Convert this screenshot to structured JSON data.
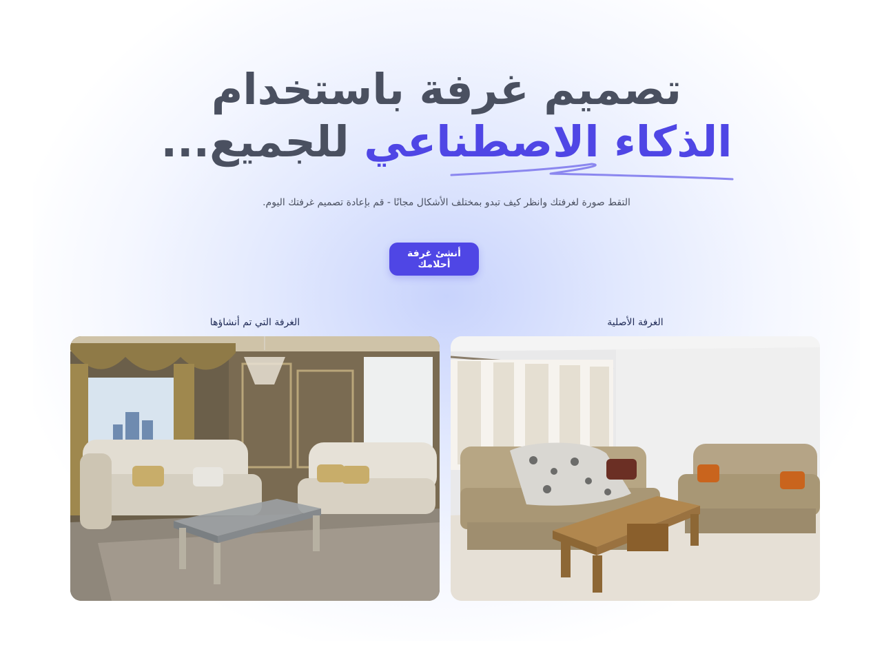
{
  "hero": {
    "title_line1": "تصميم غرفة باستخدام",
    "title_highlight": "الذكاء الاصطناعي",
    "title_suffix": "للجميع...",
    "subtitle": "التقط صورة لغرفتك وانظر كيف تبدو بمختلف الأشكال مجانًا - قم بإعادة تصميم غرفتك اليوم.",
    "cta_label": "أنشئ غرفة أحلامك"
  },
  "comparison": {
    "original_label": "الغرفة الأصلية",
    "generated_label": "الغرفة التي تم أنشاؤها"
  },
  "colors": {
    "accent": "#4f46e5",
    "title_text": "#4a5060",
    "label_text": "#1f2a55"
  }
}
